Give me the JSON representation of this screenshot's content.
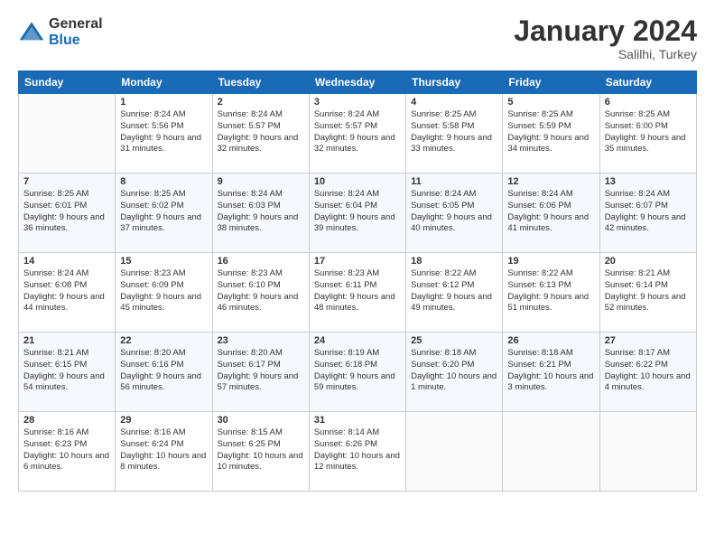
{
  "logo": {
    "general": "General",
    "blue": "Blue"
  },
  "header": {
    "month_year": "January 2024",
    "location": "Salilhi, Turkey"
  },
  "weekdays": [
    "Sunday",
    "Monday",
    "Tuesday",
    "Wednesday",
    "Thursday",
    "Friday",
    "Saturday"
  ],
  "weeks": [
    [
      {
        "day": "",
        "sunrise": "",
        "sunset": "",
        "daylight": ""
      },
      {
        "day": "1",
        "sunrise": "Sunrise: 8:24 AM",
        "sunset": "Sunset: 5:56 PM",
        "daylight": "Daylight: 9 hours and 31 minutes."
      },
      {
        "day": "2",
        "sunrise": "Sunrise: 8:24 AM",
        "sunset": "Sunset: 5:57 PM",
        "daylight": "Daylight: 9 hours and 32 minutes."
      },
      {
        "day": "3",
        "sunrise": "Sunrise: 8:24 AM",
        "sunset": "Sunset: 5:57 PM",
        "daylight": "Daylight: 9 hours and 32 minutes."
      },
      {
        "day": "4",
        "sunrise": "Sunrise: 8:25 AM",
        "sunset": "Sunset: 5:58 PM",
        "daylight": "Daylight: 9 hours and 33 minutes."
      },
      {
        "day": "5",
        "sunrise": "Sunrise: 8:25 AM",
        "sunset": "Sunset: 5:59 PM",
        "daylight": "Daylight: 9 hours and 34 minutes."
      },
      {
        "day": "6",
        "sunrise": "Sunrise: 8:25 AM",
        "sunset": "Sunset: 6:00 PM",
        "daylight": "Daylight: 9 hours and 35 minutes."
      }
    ],
    [
      {
        "day": "7",
        "sunrise": "Sunrise: 8:25 AM",
        "sunset": "Sunset: 6:01 PM",
        "daylight": "Daylight: 9 hours and 36 minutes."
      },
      {
        "day": "8",
        "sunrise": "Sunrise: 8:25 AM",
        "sunset": "Sunset: 6:02 PM",
        "daylight": "Daylight: 9 hours and 37 minutes."
      },
      {
        "day": "9",
        "sunrise": "Sunrise: 8:24 AM",
        "sunset": "Sunset: 6:03 PM",
        "daylight": "Daylight: 9 hours and 38 minutes."
      },
      {
        "day": "10",
        "sunrise": "Sunrise: 8:24 AM",
        "sunset": "Sunset: 6:04 PM",
        "daylight": "Daylight: 9 hours and 39 minutes."
      },
      {
        "day": "11",
        "sunrise": "Sunrise: 8:24 AM",
        "sunset": "Sunset: 6:05 PM",
        "daylight": "Daylight: 9 hours and 40 minutes."
      },
      {
        "day": "12",
        "sunrise": "Sunrise: 8:24 AM",
        "sunset": "Sunset: 6:06 PM",
        "daylight": "Daylight: 9 hours and 41 minutes."
      },
      {
        "day": "13",
        "sunrise": "Sunrise: 8:24 AM",
        "sunset": "Sunset: 6:07 PM",
        "daylight": "Daylight: 9 hours and 42 minutes."
      }
    ],
    [
      {
        "day": "14",
        "sunrise": "Sunrise: 8:24 AM",
        "sunset": "Sunset: 6:08 PM",
        "daylight": "Daylight: 9 hours and 44 minutes."
      },
      {
        "day": "15",
        "sunrise": "Sunrise: 8:23 AM",
        "sunset": "Sunset: 6:09 PM",
        "daylight": "Daylight: 9 hours and 45 minutes."
      },
      {
        "day": "16",
        "sunrise": "Sunrise: 8:23 AM",
        "sunset": "Sunset: 6:10 PM",
        "daylight": "Daylight: 9 hours and 46 minutes."
      },
      {
        "day": "17",
        "sunrise": "Sunrise: 8:23 AM",
        "sunset": "Sunset: 6:11 PM",
        "daylight": "Daylight: 9 hours and 48 minutes."
      },
      {
        "day": "18",
        "sunrise": "Sunrise: 8:22 AM",
        "sunset": "Sunset: 6:12 PM",
        "daylight": "Daylight: 9 hours and 49 minutes."
      },
      {
        "day": "19",
        "sunrise": "Sunrise: 8:22 AM",
        "sunset": "Sunset: 6:13 PM",
        "daylight": "Daylight: 9 hours and 51 minutes."
      },
      {
        "day": "20",
        "sunrise": "Sunrise: 8:21 AM",
        "sunset": "Sunset: 6:14 PM",
        "daylight": "Daylight: 9 hours and 52 minutes."
      }
    ],
    [
      {
        "day": "21",
        "sunrise": "Sunrise: 8:21 AM",
        "sunset": "Sunset: 6:15 PM",
        "daylight": "Daylight: 9 hours and 54 minutes."
      },
      {
        "day": "22",
        "sunrise": "Sunrise: 8:20 AM",
        "sunset": "Sunset: 6:16 PM",
        "daylight": "Daylight: 9 hours and 56 minutes."
      },
      {
        "day": "23",
        "sunrise": "Sunrise: 8:20 AM",
        "sunset": "Sunset: 6:17 PM",
        "daylight": "Daylight: 9 hours and 57 minutes."
      },
      {
        "day": "24",
        "sunrise": "Sunrise: 8:19 AM",
        "sunset": "Sunset: 6:18 PM",
        "daylight": "Daylight: 9 hours and 59 minutes."
      },
      {
        "day": "25",
        "sunrise": "Sunrise: 8:18 AM",
        "sunset": "Sunset: 6:20 PM",
        "daylight": "Daylight: 10 hours and 1 minute."
      },
      {
        "day": "26",
        "sunrise": "Sunrise: 8:18 AM",
        "sunset": "Sunset: 6:21 PM",
        "daylight": "Daylight: 10 hours and 3 minutes."
      },
      {
        "day": "27",
        "sunrise": "Sunrise: 8:17 AM",
        "sunset": "Sunset: 6:22 PM",
        "daylight": "Daylight: 10 hours and 4 minutes."
      }
    ],
    [
      {
        "day": "28",
        "sunrise": "Sunrise: 8:16 AM",
        "sunset": "Sunset: 6:23 PM",
        "daylight": "Daylight: 10 hours and 6 minutes."
      },
      {
        "day": "29",
        "sunrise": "Sunrise: 8:16 AM",
        "sunset": "Sunset: 6:24 PM",
        "daylight": "Daylight: 10 hours and 8 minutes."
      },
      {
        "day": "30",
        "sunrise": "Sunrise: 8:15 AM",
        "sunset": "Sunset: 6:25 PM",
        "daylight": "Daylight: 10 hours and 10 minutes."
      },
      {
        "day": "31",
        "sunrise": "Sunrise: 8:14 AM",
        "sunset": "Sunset: 6:26 PM",
        "daylight": "Daylight: 10 hours and 12 minutes."
      },
      {
        "day": "",
        "sunrise": "",
        "sunset": "",
        "daylight": ""
      },
      {
        "day": "",
        "sunrise": "",
        "sunset": "",
        "daylight": ""
      },
      {
        "day": "",
        "sunrise": "",
        "sunset": "",
        "daylight": ""
      }
    ]
  ]
}
